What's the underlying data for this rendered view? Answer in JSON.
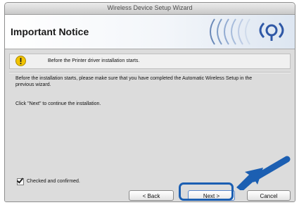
{
  "window": {
    "title": "Wireless Device Setup Wizard"
  },
  "header": {
    "heading": "Important Notice"
  },
  "notice": {
    "text": "Before the Printer driver installation starts."
  },
  "body": {
    "paragraph": "Before the installation starts, please make sure that you have completed the Automatic Wireless Setup in the previous wizard.",
    "continue_text": "Click \"Next\" to continue the installation."
  },
  "confirm": {
    "label": "Checked and confirmed.",
    "checked": true
  },
  "buttons": {
    "back": "< Back",
    "next": "Next >",
    "cancel": "Cancel"
  },
  "colors": {
    "callout": "#1c5fb2",
    "warning": "#f2c400"
  },
  "icons": {
    "header_logo": "wireless-signal-icon",
    "notice": "warning-icon",
    "callout": "pointer-arrow-icon"
  }
}
